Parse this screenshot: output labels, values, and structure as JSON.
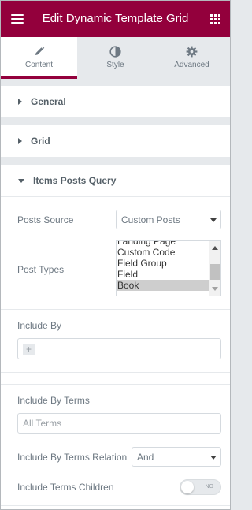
{
  "header": {
    "title": "Edit Dynamic Template Grid",
    "menu_icon": "hamburger-icon",
    "apps_icon": "grid-icon"
  },
  "tabs": [
    {
      "label": "Content",
      "icon": "pencil-icon",
      "active": true
    },
    {
      "label": "Style",
      "icon": "contrast-icon",
      "active": false
    },
    {
      "label": "Advanced",
      "icon": "gear-icon",
      "active": false
    }
  ],
  "sections": {
    "general": "General",
    "grid": "Grid",
    "items_posts_query": "Items Posts Query"
  },
  "controls": {
    "posts_source": {
      "label": "Posts Source",
      "value": "Custom Posts"
    },
    "post_types": {
      "label": "Post Types",
      "options": [
        "Landing Page",
        "Custom Code",
        "Field Group",
        "Field",
        "Book"
      ],
      "selected": "Book"
    },
    "include_by": {
      "label": "Include By",
      "add_symbol": "+"
    },
    "include_by_terms": {
      "label": "Include By Terms",
      "placeholder": "All Terms"
    },
    "include_by_terms_relation": {
      "label": "Include By Terms Relation",
      "value": "And"
    },
    "include_terms_children": {
      "label": "Include Terms Children",
      "switch_text": "NO"
    }
  },
  "colors": {
    "brand": "#93003c",
    "panel_bg": "#e6e9ec",
    "text": "#6d7882"
  }
}
